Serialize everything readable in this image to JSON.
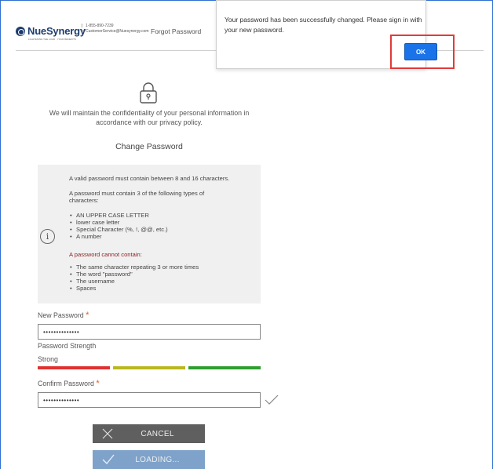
{
  "header": {
    "logo": "NueSynergy",
    "tagline": "LIGHTENING THE LOAD · YOUR BENEFITS",
    "phone": "1-855-890-7239",
    "email": "CustomerService@Nuesynergy.com",
    "page_title": "Forgot Password"
  },
  "dialog": {
    "message": "Your password has been successfully changed. Please sign in with your new password.",
    "ok_label": "OK"
  },
  "intro": {
    "privacy_text": "We will maintain the confidentiality of your personal information in accordance with our privacy policy.",
    "form_title": "Change Password"
  },
  "rules": {
    "length_rule": "A valid password must contain between 8 and 16 characters.",
    "types_intro": "A password must contain 3 of the following types of characters:",
    "types": [
      "AN UPPER CASE LETTER",
      "lower case letter",
      "Special Character (%, !, @@, etc.)",
      "A number"
    ],
    "cannot_label": "A password cannot contain:",
    "cannot": [
      "The same character repeating 3 or more times",
      "The word \"password\"",
      "The username",
      "Spaces"
    ]
  },
  "form": {
    "new_password_label": "New Password",
    "new_password_value": "••••••••••••••",
    "strength_label": "Password Strength",
    "strength_value": "Strong",
    "strength_colors": [
      "#e03131",
      "#b8b81e",
      "#2f9e2f"
    ],
    "confirm_password_label": "Confirm Password",
    "confirm_password_value": "••••••••••••••",
    "required_marker": "*"
  },
  "buttons": {
    "cancel_label": "CANCEL",
    "loading_label": "LOADING..."
  },
  "colors": {
    "ok_button": "#1a73e8",
    "highlight": "#e23a3a",
    "loading_button": "#7ea2c9",
    "cancel_button": "#5f5f5f"
  }
}
